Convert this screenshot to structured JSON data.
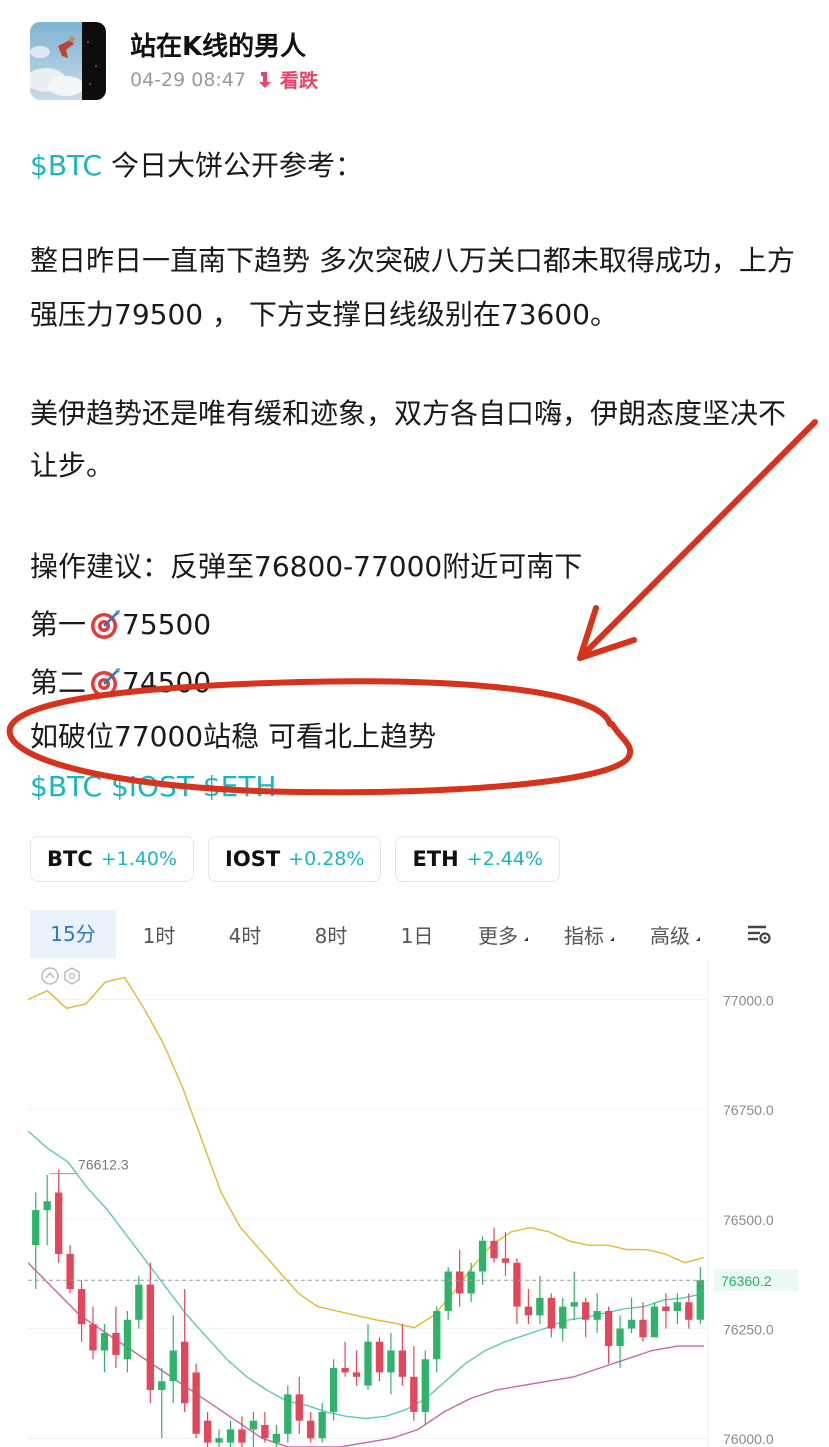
{
  "author": {
    "name": "站在K线的男人",
    "time": "04-29 08:47",
    "sentiment": "看跌",
    "sentiment_color": "#e8456b"
  },
  "post": {
    "intro_tag": "$BTC",
    "intro_text": " 今日大饼公开参考：",
    "para1": "整日昨日一直南下趋势  多次突破八万关口都未取得成功，上方强压力79500 ，  下方支撑日线级别在73600。",
    "para2": "美伊趋势还是唯有缓和迹象，双方各自口嗨，伊朗态度坚决不让步。",
    "advice": "操作建议：反弹至76800-77000附近可南下",
    "target1_label": "第一",
    "target1_value": "75500",
    "target2_label": "第二",
    "target2_value": "74500",
    "breakout": "如破位77000站稳 可看北上趋势",
    "footer_tags": "$BTC $IOST $ETH"
  },
  "coins": [
    {
      "symbol": "BTC",
      "change": "+1.40%"
    },
    {
      "symbol": "IOST",
      "change": "+0.28%"
    },
    {
      "symbol": "ETH",
      "change": "+2.44%"
    }
  ],
  "tabs": [
    "15分",
    "1时",
    "4时",
    "8时",
    "1日",
    "更多",
    "指标",
    "高级"
  ],
  "colors": {
    "up": "#2fb36a",
    "down": "#e2475b",
    "accent": "#1bb5c1",
    "annotation": "#d6321c"
  },
  "chart_data": {
    "type": "candlestick",
    "ylim": [
      75980,
      77090
    ],
    "y_ticks": [
      "77000.0",
      "76750.0",
      "76500.0",
      "76250.0",
      "76000.0"
    ],
    "y_tick_values": [
      77000,
      76750,
      76500,
      76250,
      76000
    ],
    "high_label": "76612.3",
    "high_value": 76612.3,
    "last_price": "76360.2",
    "last_value": 76360.2,
    "candles": [
      {
        "o": 76440,
        "h": 76560,
        "l": 76340,
        "c": 76520
      },
      {
        "o": 76520,
        "h": 76600,
        "l": 76440,
        "c": 76540
      },
      {
        "o": 76560,
        "h": 76612,
        "l": 76400,
        "c": 76420
      },
      {
        "o": 76420,
        "h": 76440,
        "l": 76330,
        "c": 76340
      },
      {
        "o": 76340,
        "h": 76360,
        "l": 76220,
        "c": 76260
      },
      {
        "o": 76260,
        "h": 76300,
        "l": 76180,
        "c": 76200
      },
      {
        "o": 76200,
        "h": 76260,
        "l": 76150,
        "c": 76240
      },
      {
        "o": 76240,
        "h": 76300,
        "l": 76160,
        "c": 76190
      },
      {
        "o": 76180,
        "h": 76290,
        "l": 76150,
        "c": 76270
      },
      {
        "o": 76270,
        "h": 76370,
        "l": 76250,
        "c": 76350
      },
      {
        "o": 76350,
        "h": 76400,
        "l": 76080,
        "c": 76110
      },
      {
        "o": 76110,
        "h": 76160,
        "l": 76000,
        "c": 76130
      },
      {
        "o": 76130,
        "h": 76280,
        "l": 76080,
        "c": 76200
      },
      {
        "o": 76220,
        "h": 76340,
        "l": 76060,
        "c": 76080
      },
      {
        "o": 76150,
        "h": 76170,
        "l": 76000,
        "c": 76010
      },
      {
        "o": 76040,
        "h": 76060,
        "l": 75980,
        "c": 75990
      },
      {
        "o": 75990,
        "h": 76020,
        "l": 75980,
        "c": 76000
      },
      {
        "o": 75990,
        "h": 76040,
        "l": 75980,
        "c": 76020
      },
      {
        "o": 76020,
        "h": 76050,
        "l": 75980,
        "c": 75990
      },
      {
        "o": 76020,
        "h": 76060,
        "l": 75980,
        "c": 76040
      },
      {
        "o": 76030,
        "h": 76060,
        "l": 75990,
        "c": 76000
      },
      {
        "o": 75990,
        "h": 76030,
        "l": 75980,
        "c": 76010
      },
      {
        "o": 76010,
        "h": 76120,
        "l": 75990,
        "c": 76100
      },
      {
        "o": 76100,
        "h": 76140,
        "l": 76010,
        "c": 76040
      },
      {
        "o": 76040,
        "h": 76060,
        "l": 75990,
        "c": 76000
      },
      {
        "o": 76000,
        "h": 76080,
        "l": 75990,
        "c": 76060
      },
      {
        "o": 76060,
        "h": 76180,
        "l": 76040,
        "c": 76160
      },
      {
        "o": 76160,
        "h": 76220,
        "l": 76140,
        "c": 76150
      },
      {
        "o": 76150,
        "h": 76200,
        "l": 76120,
        "c": 76140
      },
      {
        "o": 76120,
        "h": 76260,
        "l": 76110,
        "c": 76220
      },
      {
        "o": 76220,
        "h": 76230,
        "l": 76130,
        "c": 76150
      },
      {
        "o": 76150,
        "h": 76240,
        "l": 76100,
        "c": 76200
      },
      {
        "o": 76200,
        "h": 76260,
        "l": 76120,
        "c": 76140
      },
      {
        "o": 76140,
        "h": 76210,
        "l": 76040,
        "c": 76060
      },
      {
        "o": 76060,
        "h": 76200,
        "l": 76030,
        "c": 76180
      },
      {
        "o": 76180,
        "h": 76300,
        "l": 76150,
        "c": 76290
      },
      {
        "o": 76290,
        "h": 76390,
        "l": 76270,
        "c": 76380
      },
      {
        "o": 76380,
        "h": 76430,
        "l": 76300,
        "c": 76330
      },
      {
        "o": 76330,
        "h": 76400,
        "l": 76310,
        "c": 76380
      },
      {
        "o": 76380,
        "h": 76460,
        "l": 76350,
        "c": 76450
      },
      {
        "o": 76450,
        "h": 76480,
        "l": 76400,
        "c": 76410
      },
      {
        "o": 76410,
        "h": 76470,
        "l": 76370,
        "c": 76400
      },
      {
        "o": 76400,
        "h": 76410,
        "l": 76260,
        "c": 76300
      },
      {
        "o": 76300,
        "h": 76340,
        "l": 76260,
        "c": 76280
      },
      {
        "o": 76280,
        "h": 76370,
        "l": 76260,
        "c": 76320
      },
      {
        "o": 76320,
        "h": 76330,
        "l": 76230,
        "c": 76250
      },
      {
        "o": 76250,
        "h": 76320,
        "l": 76220,
        "c": 76300
      },
      {
        "o": 76300,
        "h": 76380,
        "l": 76270,
        "c": 76310
      },
      {
        "o": 76310,
        "h": 76320,
        "l": 76230,
        "c": 76270
      },
      {
        "o": 76270,
        "h": 76330,
        "l": 76240,
        "c": 76290
      },
      {
        "o": 76290,
        "h": 76300,
        "l": 76170,
        "c": 76210
      },
      {
        "o": 76210,
        "h": 76280,
        "l": 76160,
        "c": 76250
      },
      {
        "o": 76250,
        "h": 76320,
        "l": 76240,
        "c": 76270
      },
      {
        "o": 76270,
        "h": 76310,
        "l": 76220,
        "c": 76230
      },
      {
        "o": 76230,
        "h": 76310,
        "l": 76230,
        "c": 76300
      },
      {
        "o": 76300,
        "h": 76330,
        "l": 76250,
        "c": 76290
      },
      {
        "o": 76290,
        "h": 76330,
        "l": 76260,
        "c": 76310
      },
      {
        "o": 76310,
        "h": 76330,
        "l": 76250,
        "c": 76270
      },
      {
        "o": 76270,
        "h": 76390,
        "l": 76260,
        "c": 76360
      }
    ],
    "ma_yellow": [
      77000,
      77020,
      76980,
      76990,
      77040,
      77050,
      76980,
      76900,
      76800,
      76680,
      76560,
      76480,
      76430,
      76380,
      76330,
      76300,
      76290,
      76280,
      76270,
      76262,
      76252,
      76280,
      76330,
      76390,
      76440,
      76470,
      76480,
      76470,
      76450,
      76440,
      76440,
      76430,
      76430,
      76420,
      76400,
      76412
    ],
    "ma_teal": [
      76700,
      76660,
      76630,
      76570,
      76520,
      76460,
      76400,
      76340,
      76280,
      76230,
      76180,
      76140,
      76110,
      76085,
      76075,
      76060,
      76050,
      76045,
      76050,
      76065,
      76090,
      76130,
      76170,
      76200,
      76220,
      76235,
      76250,
      76268,
      76275,
      76285,
      76295,
      76300,
      76315,
      76320,
      76330
    ],
    "ma_pink": [
      76400,
      76340,
      76280,
      76240,
      76200,
      76160,
      76120,
      76080,
      76040,
      76000,
      75980,
      75980,
      75980,
      75990,
      76000,
      76020,
      76060,
      76090,
      76110,
      76120,
      76130,
      76140,
      76160,
      76180,
      76200,
      76210,
      76210
    ]
  }
}
